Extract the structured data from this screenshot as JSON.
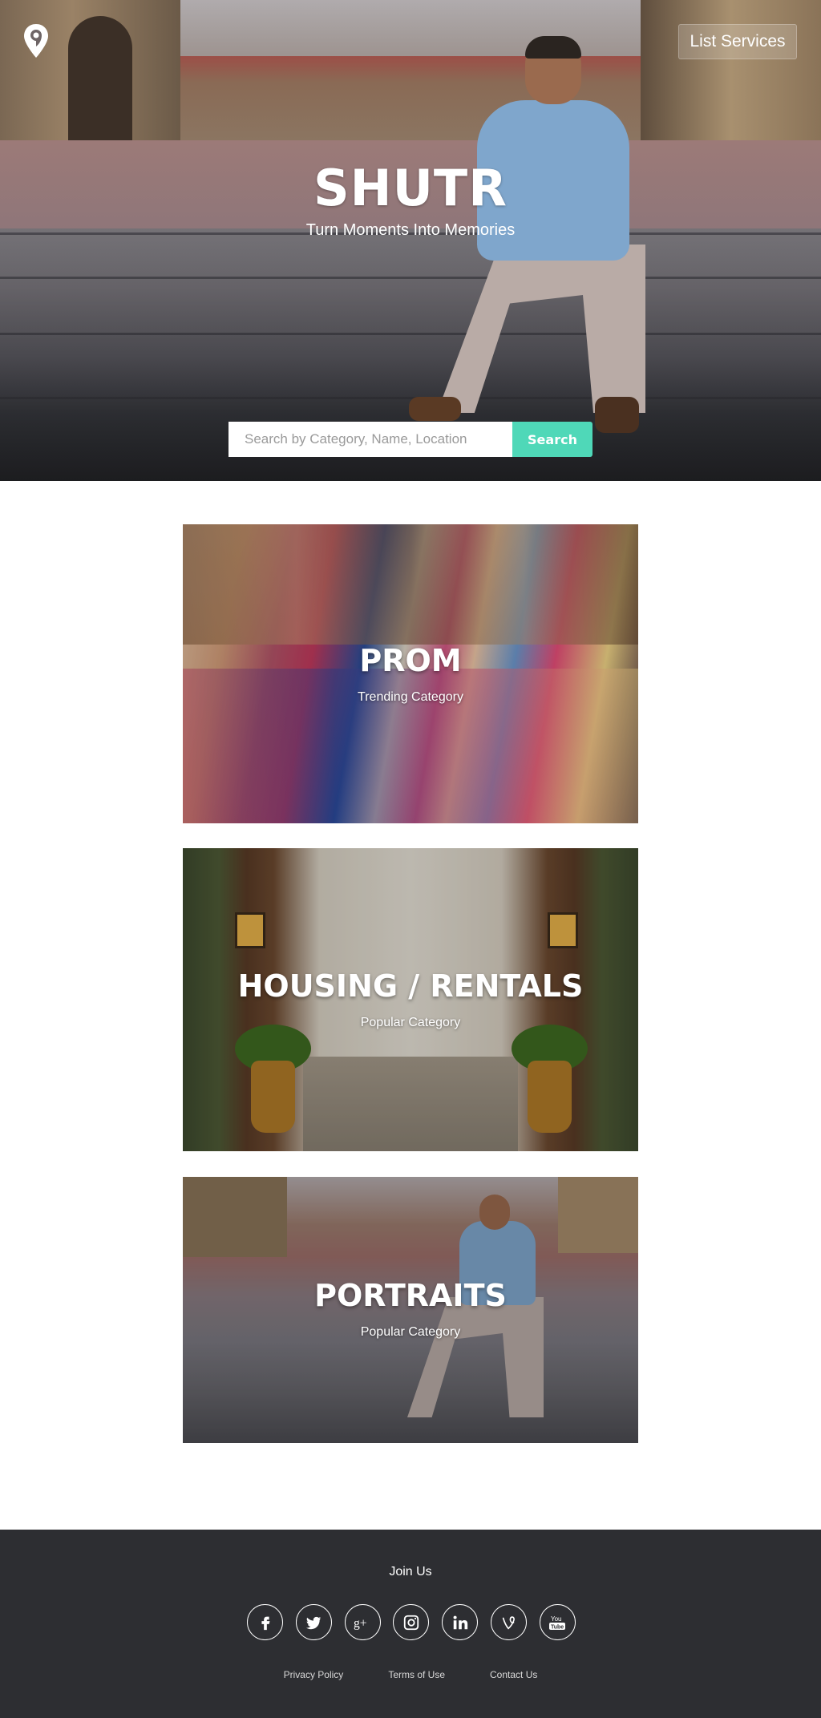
{
  "header": {
    "list_services_label": "List Services"
  },
  "hero": {
    "title": "SHUTR",
    "subtitle": "Turn Moments Into Memories",
    "search_placeholder": "Search by Category, Name, Location",
    "search_button_label": "Search"
  },
  "categories": [
    {
      "title": "PROM",
      "subtitle": "Trending Category"
    },
    {
      "title": "HOUSING / RENTALS",
      "subtitle": "Popular Category"
    },
    {
      "title": "PORTRAITS",
      "subtitle": "Popular Category"
    }
  ],
  "footer": {
    "join_label": "Join Us",
    "socials": [
      "facebook-icon",
      "twitter-icon",
      "google-plus-icon",
      "instagram-icon",
      "linkedin-icon",
      "vine-icon",
      "youtube-icon"
    ],
    "links": [
      "Privacy Policy",
      "Terms of Use",
      "Contact Us"
    ]
  },
  "colors": {
    "accent": "#4fd8b8",
    "footer_bg": "#2d2e32"
  }
}
